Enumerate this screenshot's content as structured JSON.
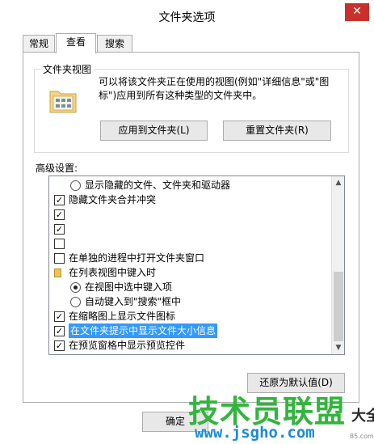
{
  "window": {
    "title": "文件夹选项",
    "close_glyph": "✕"
  },
  "tabs": [
    {
      "label": "常规"
    },
    {
      "label": "查看"
    },
    {
      "label": "搜索"
    }
  ],
  "folder_views": {
    "title": "文件夹视图",
    "description": "可以将该文件夹正在使用的视图(例如\"详细信息\"或\"图标\")应用到所有这种类型的文件夹中。",
    "apply_button": "应用到文件夹(L)",
    "reset_button": "重置文件夹(R)"
  },
  "advanced": {
    "label": "高级设置:",
    "items": [
      {
        "type": "radio",
        "checked": false,
        "indent": 1,
        "text": "显示隐藏的文件、文件夹和驱动器"
      },
      {
        "type": "checkbox",
        "checked": true,
        "indent": 0,
        "text": "隐藏文件夹合并冲突"
      },
      {
        "type": "checkbox",
        "checked": true,
        "indent": 0,
        "text": ""
      },
      {
        "type": "checkbox",
        "checked": true,
        "indent": 0,
        "text": ""
      },
      {
        "type": "checkbox",
        "checked": false,
        "indent": 0,
        "text": ""
      },
      {
        "type": "checkbox",
        "checked": false,
        "indent": 0,
        "text": "在单独的进程中打开文件夹窗口"
      },
      {
        "type": "folder",
        "checked": false,
        "indent": 0,
        "text": "在列表视图中键入时"
      },
      {
        "type": "radio",
        "checked": true,
        "indent": 1,
        "text": "在视图中选中键入项"
      },
      {
        "type": "radio",
        "checked": false,
        "indent": 1,
        "text": "自动键入到\"搜索\"框中"
      },
      {
        "type": "checkbox",
        "checked": true,
        "indent": 0,
        "text": "在缩略图上显示文件图标"
      },
      {
        "type": "checkbox",
        "checked": true,
        "indent": 0,
        "text": "在文件夹提示中显示文件大小信息",
        "selected": true
      },
      {
        "type": "checkbox",
        "checked": true,
        "indent": 0,
        "text": "在预览窗格中显示预览控件"
      }
    ],
    "scroll_up": "▲",
    "scroll_down": "▼"
  },
  "restore_button": "还原为默认值(D)",
  "footer": {
    "ok_button": "确定"
  },
  "watermark": {
    "big": "技术员联盟",
    "small": "大全",
    "url": "www.jsgho.com",
    "url_small": "85.com"
  },
  "colors": {
    "selection": "#3399ff",
    "close": "#c9302c",
    "watermark_green": "#33b53d",
    "watermark_blue": "#1a8bd6"
  }
}
